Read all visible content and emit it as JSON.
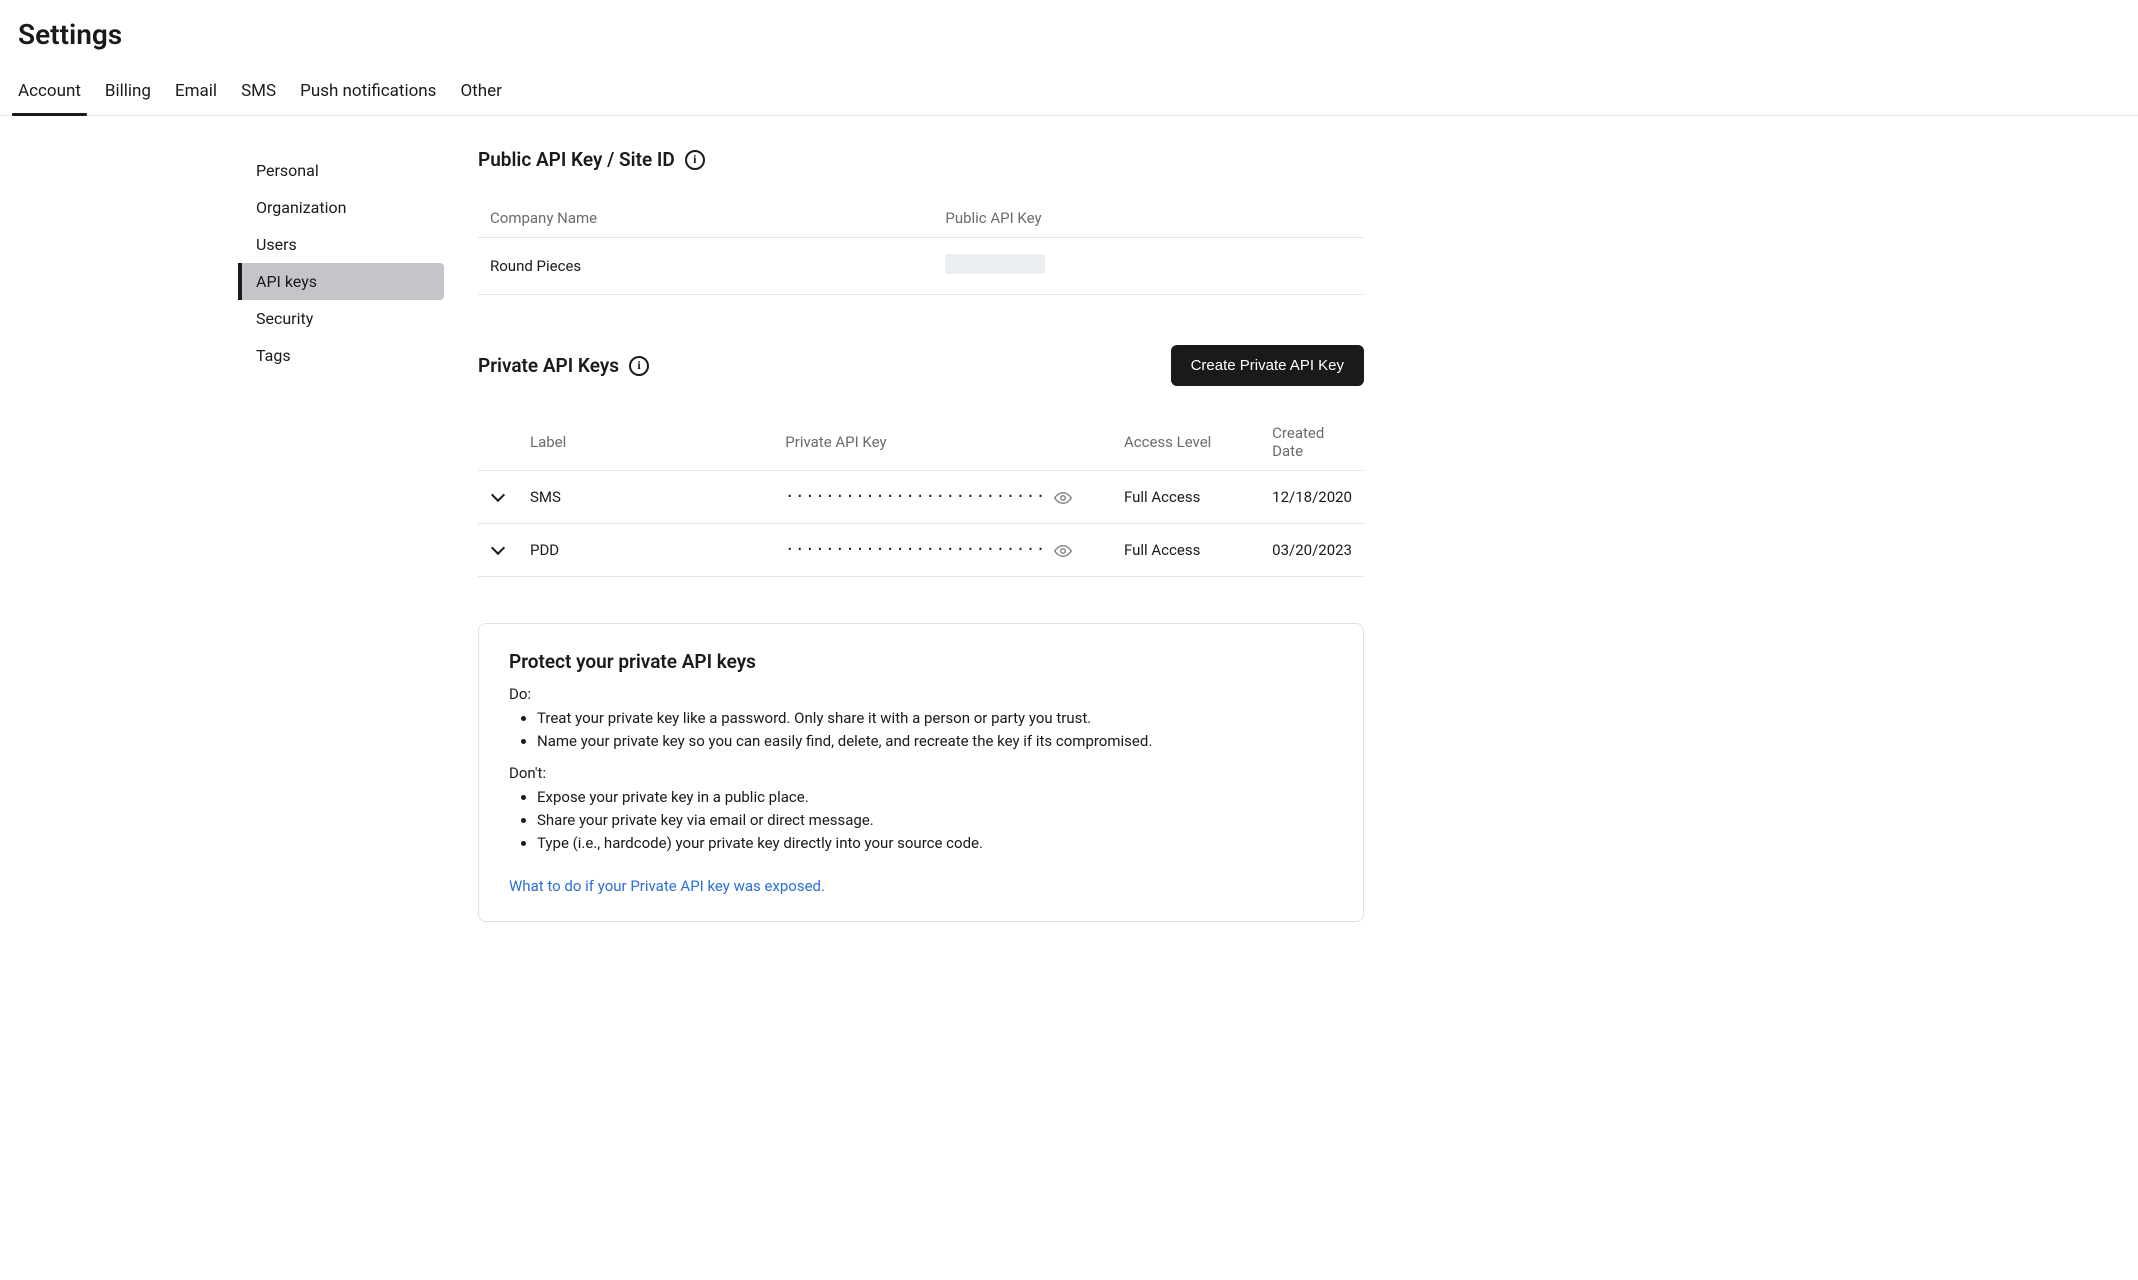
{
  "page_title": "Settings",
  "tabs": [
    {
      "label": "Account",
      "active": true
    },
    {
      "label": "Billing",
      "active": false
    },
    {
      "label": "Email",
      "active": false
    },
    {
      "label": "SMS",
      "active": false
    },
    {
      "label": "Push notifications",
      "active": false
    },
    {
      "label": "Other",
      "active": false
    }
  ],
  "sidebar": [
    {
      "label": "Personal",
      "active": false
    },
    {
      "label": "Organization",
      "active": false
    },
    {
      "label": "Users",
      "active": false
    },
    {
      "label": "API keys",
      "active": true
    },
    {
      "label": "Security",
      "active": false
    },
    {
      "label": "Tags",
      "active": false
    }
  ],
  "public_section": {
    "title": "Public API Key / Site ID",
    "columns": {
      "company": "Company Name",
      "key": "Public API Key"
    },
    "rows": [
      {
        "company": "Round Pieces",
        "key_redacted": true
      }
    ]
  },
  "private_section": {
    "title": "Private API Keys",
    "create_button": "Create Private API Key",
    "columns": {
      "label": "Label",
      "key": "Private API Key",
      "access": "Access Level",
      "created": "Created Date"
    },
    "rows": [
      {
        "label": "SMS",
        "key_mask": "··························",
        "access": "Full Access",
        "created": "12/18/2020"
      },
      {
        "label": "PDD",
        "key_mask": "··························",
        "access": "Full Access",
        "created": "03/20/2023"
      }
    ]
  },
  "protect_box": {
    "title": "Protect your private API keys",
    "do_label": "Do:",
    "do_items": [
      "Treat your private key like a password. Only share it with a person or party you trust.",
      "Name your private key so you can easily find, delete, and recreate the key if its compromised."
    ],
    "dont_label": "Don't:",
    "dont_items": [
      "Expose your private key in a public place.",
      "Share your private key via email or direct message.",
      "Type (i.e., hardcode) your private key directly into your source code."
    ],
    "link": "What to do if your Private API key was exposed."
  }
}
